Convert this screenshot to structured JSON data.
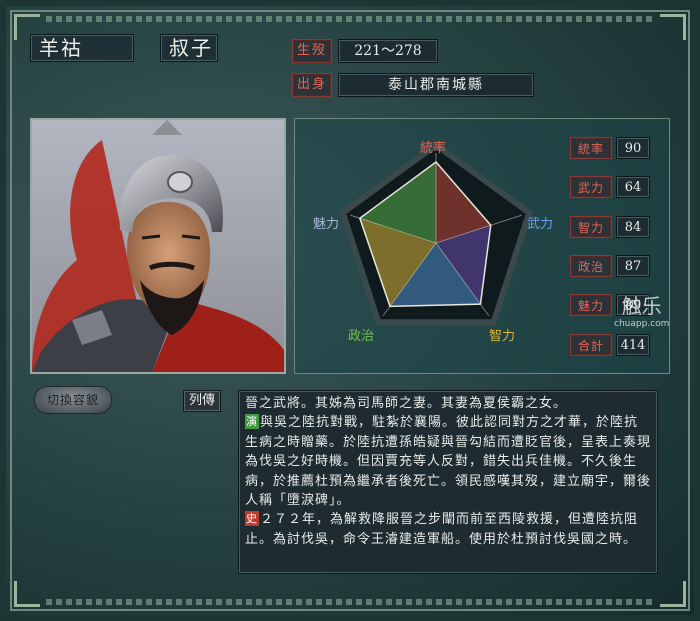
{
  "character": {
    "name": "羊祜",
    "courtesy_name": "叔子",
    "lifespan_label": "生歿",
    "lifespan": "221～278",
    "origin_label": "出身",
    "origin": "泰山郡南城縣"
  },
  "radar": {
    "axes": [
      "統率",
      "武力",
      "智力",
      "政治",
      "魅力"
    ],
    "values": [
      90,
      64,
      84,
      87,
      89
    ],
    "max": 100
  },
  "stats": [
    {
      "label": "統率",
      "value": "90"
    },
    {
      "label": "武力",
      "value": "64"
    },
    {
      "label": "智力",
      "value": "84"
    },
    {
      "label": "政治",
      "value": "87"
    },
    {
      "label": "魅力",
      "value": "89"
    },
    {
      "label": "合計",
      "value": "414"
    }
  ],
  "buttons": {
    "switch_portrait": "切換容貌"
  },
  "biography": {
    "label": "列傳",
    "tag_yan": "演",
    "tag_shi": "史",
    "line1": "晉之武將。其姊為司馬師之妻。其妻為夏侯霸之女。",
    "line2": "與吳之陸抗對戰，駐紮於襄陽。彼此認同對方之才華，於陸抗生病之時贈藥。於陸抗遭孫皓疑與晉勾結而遭貶官後，呈表上奏現為伐吳之好時機。但因賈充等人反對，錯失出兵佳機。不久後生病，於推薦杜預為繼承者後死亡。領民感嘆其歿，建立廟宇，爾後人稱「墮淚碑」。",
    "line3": "２７２年，為解救降服晉之步闡而前至西陵救援，但遭陸抗阻止。為討伐吳，命令王濬建造軍船。使用於杜預討伐吳國之時。"
  },
  "watermark": {
    "main": "触乐",
    "sub": "chuapp.com"
  },
  "colors": {
    "label_red": "#e46557",
    "panel_teal": "#24403f"
  }
}
